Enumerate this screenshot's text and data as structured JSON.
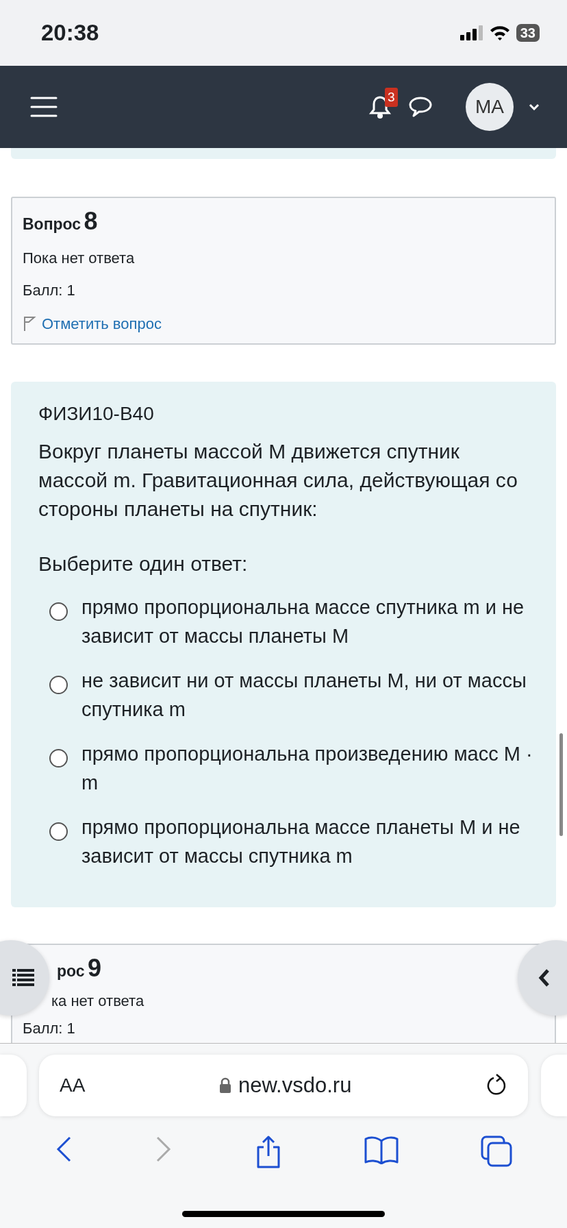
{
  "status_bar": {
    "time": "20:38",
    "battery": "33"
  },
  "navbar": {
    "notifications_count": "3",
    "avatar_initials": "MA"
  },
  "question_8": {
    "label": "Вопрос",
    "number": "8",
    "state": "Пока нет ответа",
    "grade": "Балл: 1",
    "flag_link": "Отметить вопрос"
  },
  "question_text": {
    "code": "ФИЗИ10-В40",
    "text": "Вокруг планеты массой M движется спутник массой m. Гравитационная сила, действующая со стороны планеты на спутник:",
    "prompt": "Выберите один ответ:",
    "options": [
      {
        "text": "прямо пропорциональна массе спутника m и не зависит от массы планеты M",
        "selected": false
      },
      {
        "text": "не зависит ни от массы планеты M, ни от массы спутника m",
        "selected": false
      },
      {
        "text": "прямо пропорциональна произведению масс M · m",
        "selected": false
      },
      {
        "text": "прямо пропорциональна массе планеты M и не зависит от массы спутника m",
        "selected": false
      }
    ]
  },
  "question_9": {
    "label": "рос",
    "number": "9",
    "state": "ка нет ответа",
    "grade": "Балл: 1"
  },
  "browser": {
    "text_size": "AA",
    "url": "new.vsdo.ru"
  }
}
